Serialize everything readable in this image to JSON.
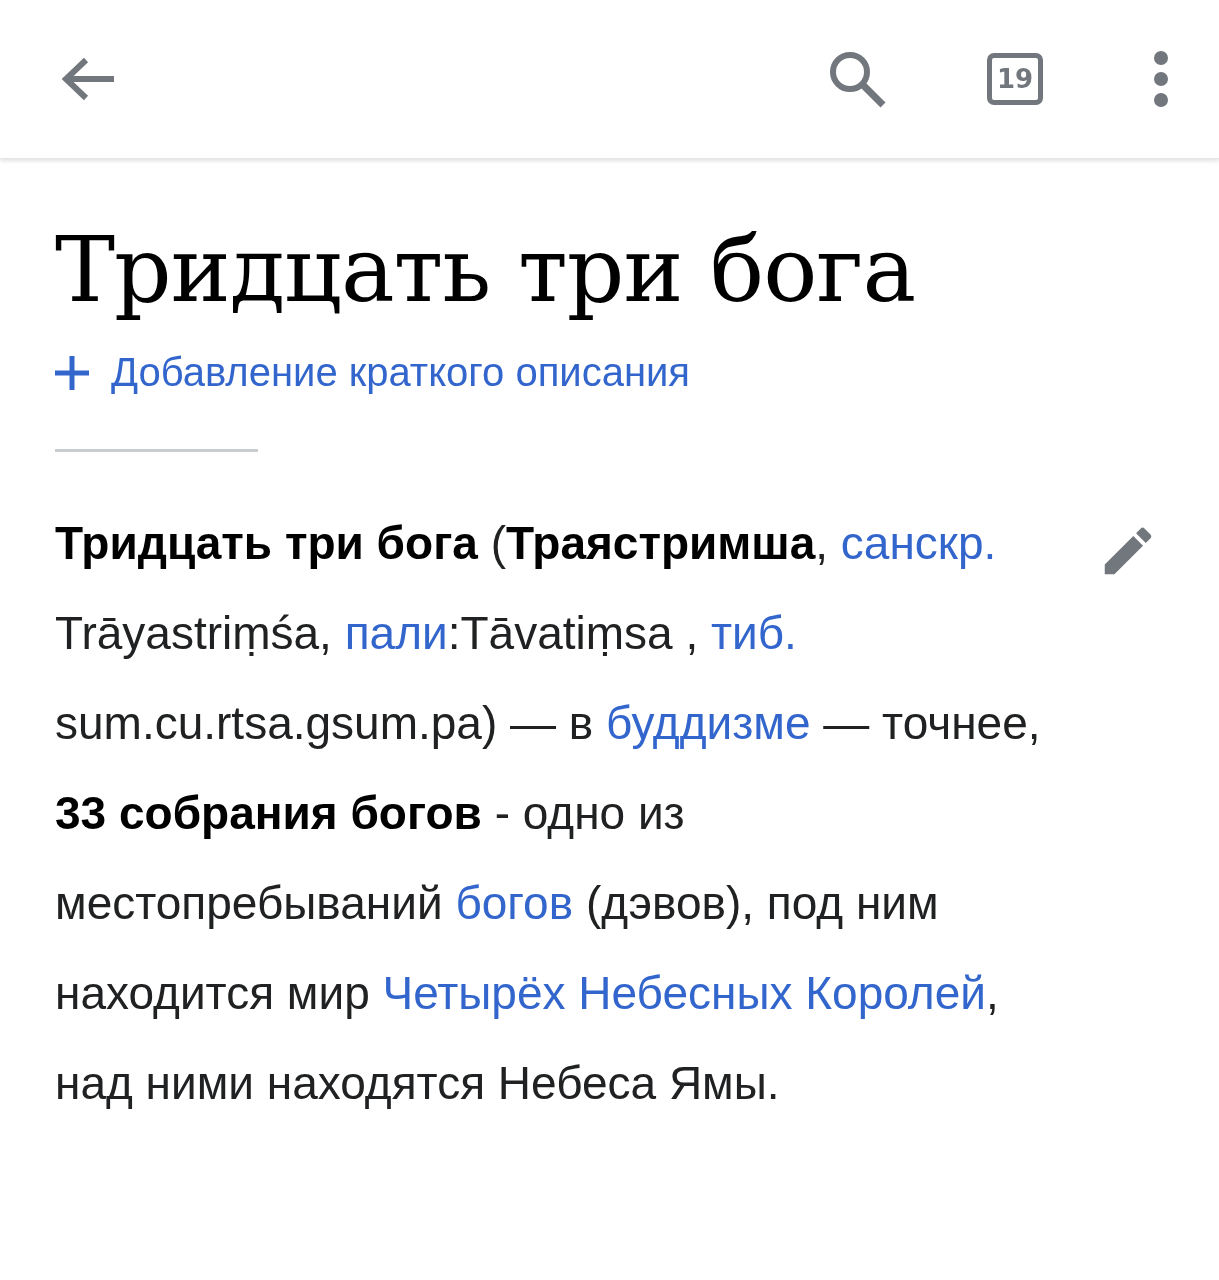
{
  "toolbar": {
    "tabs_count": "19"
  },
  "article": {
    "title": "Тридцать три бога",
    "add_description": "Добавление краткого описания",
    "paragraph": [
      {
        "kind": "bold",
        "text": "Тридцать три бога"
      },
      {
        "kind": "text",
        "text": " ("
      },
      {
        "kind": "bold",
        "text": "Траястримша"
      },
      {
        "kind": "text",
        "text": ", "
      },
      {
        "kind": "link",
        "text": "санскр."
      },
      {
        "kind": "text",
        "text": " Trāyastriṃśa, "
      },
      {
        "kind": "link",
        "text": "пали"
      },
      {
        "kind": "text",
        "text": ":Tāvatiṃsa , "
      },
      {
        "kind": "link",
        "text": "тиб."
      },
      {
        "kind": "text",
        "text": " sum.cu.rtsa.gsum.pa) — в "
      },
      {
        "kind": "link",
        "text": "буддизме"
      },
      {
        "kind": "text",
        "text": " — точнее, "
      },
      {
        "kind": "bold",
        "text": "33 собрания богов"
      },
      {
        "kind": "text",
        "text": " - одно из местопребываний "
      },
      {
        "kind": "link",
        "text": "богов"
      },
      {
        "kind": "text",
        "text": " (дэвов), под ним находится мир "
      },
      {
        "kind": "link",
        "text": "Четырёх Небесных Королей"
      },
      {
        "kind": "text",
        "text": ", над ними находятся Небеса Ямы."
      }
    ]
  }
}
